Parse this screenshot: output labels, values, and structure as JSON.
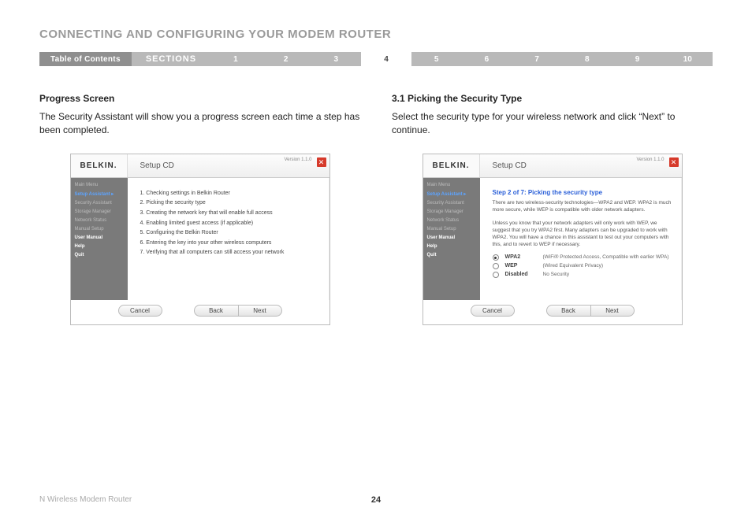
{
  "page_title": "CONNECTING AND CONFIGURING YOUR MODEM ROUTER",
  "navbar": {
    "toc": "Table of Contents",
    "sections_label": "SECTIONS",
    "numbers": [
      "1",
      "2",
      "3",
      "4",
      "5",
      "6",
      "7",
      "8",
      "9",
      "10"
    ],
    "active_index": 3
  },
  "left": {
    "heading": "Progress Screen",
    "body": "The Security Assistant will show you a progress screen each time a step has been completed.",
    "shot": {
      "brand": "BELKIN.",
      "title": "Setup CD",
      "version": "Version 1.1.0",
      "close": "✕",
      "sidebar": [
        {
          "label": "Main Menu",
          "cls": ""
        },
        {
          "label": "Setup Assistant  ▸",
          "cls": "active"
        },
        {
          "label": "Security Assistant",
          "cls": ""
        },
        {
          "label": "Storage Manager",
          "cls": ""
        },
        {
          "label": "Network Status",
          "cls": ""
        },
        {
          "label": "Manual Setup",
          "cls": ""
        },
        {
          "label": "User Manual",
          "cls": "white"
        },
        {
          "label": "Help",
          "cls": "white"
        },
        {
          "label": "Quit",
          "cls": "white"
        }
      ],
      "steps": [
        "1. Checking settings in Belkin Router",
        "2. Picking the security type",
        "3. Creating the network key that will enable full access",
        "4. Enabling limited guest access (if applicable)",
        "5. Configuring the Belkin Router",
        "6. Entering the key into your other wireless computers",
        "7. Verifying that all computers can still access your network"
      ],
      "buttons": {
        "cancel": "Cancel",
        "back": "Back",
        "next": "Next"
      }
    }
  },
  "right": {
    "heading": "3.1 Picking the Security Type",
    "body": "Select the security type for your wireless network and click “Next” to continue.",
    "shot": {
      "brand": "BELKIN.",
      "title": "Setup CD",
      "version": "Version 1.1.0",
      "close": "✕",
      "sidebar": [
        {
          "label": "Main Menu",
          "cls": ""
        },
        {
          "label": "Setup Assistant  ▸",
          "cls": "active"
        },
        {
          "label": "Security Assistant",
          "cls": ""
        },
        {
          "label": "Storage Manager",
          "cls": ""
        },
        {
          "label": "Network Status",
          "cls": ""
        },
        {
          "label": "Manual Setup",
          "cls": ""
        },
        {
          "label": "User Manual",
          "cls": "white"
        },
        {
          "label": "Help",
          "cls": "white"
        },
        {
          "label": "Quit",
          "cls": "white"
        }
      ],
      "step_title": "Step 2 of 7: Picking the security type",
      "step_desc1": "There are two wireless-security technologies—WPA2 and WEP. WPA2 is much more secure, while WEP is compatible with older network adapters.",
      "step_desc2": "Unless you know that your network adapters will only work with WEP, we suggest that you try WPA2 first. Many adapters can be upgraded to work with WPA2. You will have a chance in this assistant to test out your computers with this, and to revert to WEP if necessary.",
      "options": [
        {
          "checked": true,
          "label": "WPA2",
          "desc": "(WiFi® Protected Access, Compatible with earlier WPA)"
        },
        {
          "checked": false,
          "label": "WEP",
          "desc": "(Wired Equivalent Privacy)"
        },
        {
          "checked": false,
          "label": "Disabled",
          "desc": "No Security"
        }
      ],
      "buttons": {
        "cancel": "Cancel",
        "back": "Back",
        "next": "Next"
      }
    }
  },
  "footer": {
    "product": "N Wireless Modem Router",
    "page": "24"
  }
}
